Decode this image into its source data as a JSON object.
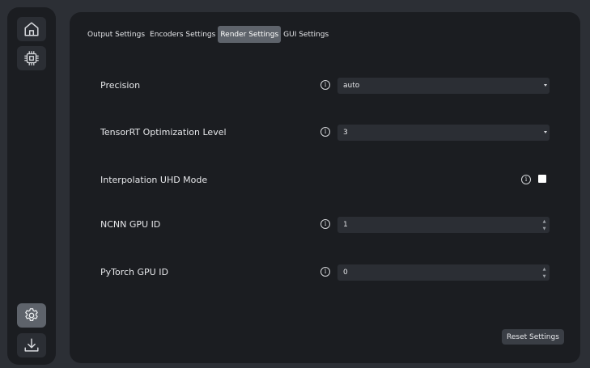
{
  "sidebar": {
    "items": [
      {
        "icon": "home-icon"
      },
      {
        "icon": "chip-icon"
      },
      {
        "icon": "gear-icon",
        "active": true
      },
      {
        "icon": "download-icon"
      }
    ]
  },
  "tabs": [
    {
      "label": "Output Settings"
    },
    {
      "label": "Encoders Settings"
    },
    {
      "label": "Render Settings",
      "active": true
    },
    {
      "label": "GUI Settings"
    }
  ],
  "settings": {
    "precision": {
      "label": "Precision",
      "value": "auto"
    },
    "trt_level": {
      "label": "TensorRT Optimization Level",
      "value": "3"
    },
    "uhd_mode": {
      "label": "Interpolation UHD Mode",
      "checked": false
    },
    "ncnn_gpu": {
      "label": "NCNN GPU ID",
      "value": "1"
    },
    "pytorch_gpu": {
      "label": "PyTorch GPU ID",
      "value": "0"
    }
  },
  "reset_label": "Reset Settings",
  "info_glyph": "i",
  "colors": {
    "background": "#2c2f35",
    "panel": "#1b1d21",
    "field": "#2b2e34",
    "active_tab": "#5e636b"
  }
}
